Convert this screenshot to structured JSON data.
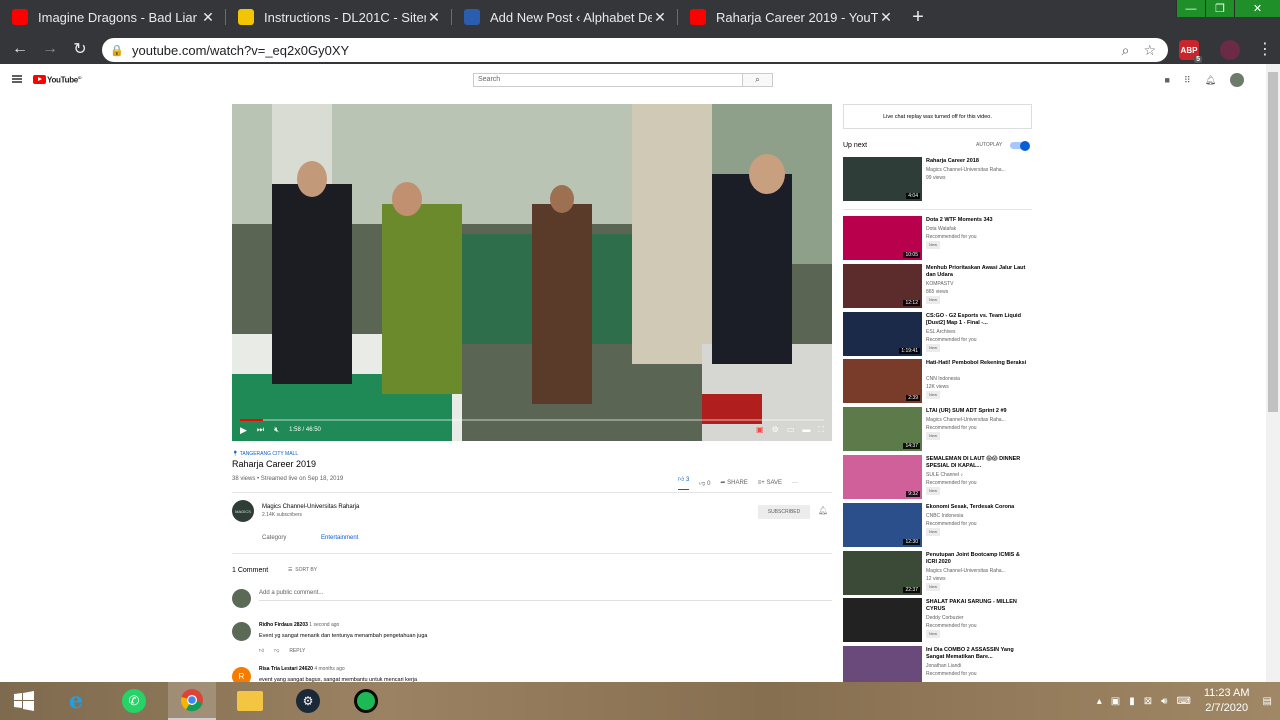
{
  "browser": {
    "tabs": [
      {
        "title": "Imagine Dragons - Bad Liar (Lyric",
        "favicon": "youtube",
        "active": false
      },
      {
        "title": "Instructions - DL201C - Sitem Ba",
        "favicon": "docs",
        "active": false
      },
      {
        "title": "Add New Post ‹ Alphabet Develo",
        "favicon": "alphabet",
        "active": false
      },
      {
        "title": "Raharja Career 2019 - YouTube",
        "favicon": "youtube",
        "active": true
      }
    ],
    "url": "youtube.com/watch?v=_eq2x0Gy0XY",
    "extension_badge": "5"
  },
  "youtube": {
    "search_placeholder": "Search",
    "video": {
      "time": "1:58 / 46:50",
      "location": "TANGERANG CITY MALL",
      "title": "Raharja Career 2019",
      "views": "38 views • Streamed live on Sep 18, 2019",
      "likes": "3",
      "dislikes": "0",
      "share_label": "SHARE",
      "save_label": "SAVE",
      "progress_fraction": 0.04
    },
    "channel": {
      "name": "Magics Channel-Universitas Raharja",
      "subscribers": "2.14K subscribers",
      "subscribe_label": "SUBSCRIBED",
      "avatar_text": "MAGICS"
    },
    "category_label": "Category",
    "category_value": "Entertainment",
    "comments": {
      "count": "1 Comment",
      "sort_label": "SORT BY",
      "add_placeholder": "Add a public comment...",
      "items": [
        {
          "author": "Ridho Firdaus 28203",
          "time": "1 second ago",
          "text": "Event yg sangat menarik dan tentunya menambah pengetahuan juga",
          "reply": "REPLY"
        },
        {
          "author": "Risa Tria Lestari 24620",
          "time": "4 months ago",
          "text": "event yang sangat bagus, sangat membantu untuk mencari kerja"
        }
      ]
    },
    "sidebar": {
      "chat_notice": "Live chat replay was turned off for this video.",
      "up_next": "Up next",
      "autoplay": "AUTOPLAY",
      "items": [
        {
          "title": "Raharja Career 2018",
          "channel": "Magics Channel-Universitas Raha...",
          "meta": "99 views",
          "duration": "4:04",
          "badge": "",
          "thumb_color": "#2f3d38"
        },
        {
          "title": "Dota 2 WTF Moments 343",
          "channel": "Dota Watafak",
          "meta": "Recommended for you",
          "duration": "10:05",
          "badge": "New",
          "thumb_color": "#b8004c"
        },
        {
          "title": "Menhub Prioritaskan Awasi Jalur Laut dan Udara",
          "channel": "KOMPASTV",
          "meta": "865 views",
          "duration": "12:12",
          "badge": "New",
          "thumb_color": "#5c2b2b"
        },
        {
          "title": "CS:GO - G2 Esports vs. Team Liquid [Dust2] Map 1 - Final -...",
          "channel": "ESL Archives",
          "meta": "Recommended for you",
          "duration": "1:19:41",
          "badge": "New",
          "thumb_color": "#1c2a4a"
        },
        {
          "title": "Hati-Hati! Pembobol Rekening Beraksi",
          "channel": "CNN Indonesia",
          "meta": "12K views",
          "duration": "2:39",
          "badge": "New",
          "thumb_color": "#7a3c2a"
        },
        {
          "title": "LTAI (UR) SUM ADT Sprint 2 #9",
          "channel": "Magics Channel-Universitas Raha...",
          "meta": "Recommended for you",
          "duration": "14:37",
          "badge": "New",
          "thumb_color": "#5d7a4a"
        },
        {
          "title": "SEMALEMAN DI LAUT 😱😱 DINNER SPESIAL DI KAPAL...",
          "channel": "SULE Channel ♪",
          "meta": "Recommended for you",
          "duration": "9:32",
          "badge": "New",
          "thumb_color": "#d0609a"
        },
        {
          "title": "Ekonomi Sesak, Terdesak Corona",
          "channel": "CNBC Indonesia",
          "meta": "Recommended for you",
          "duration": "12:30",
          "badge": "New",
          "thumb_color": "#2a4f8a"
        },
        {
          "title": "Penutupan Joint Bootcamp ICMIS & ICRI 2020",
          "channel": "Magics Channel-Universitas Raha...",
          "meta": "12 views",
          "duration": "22:37",
          "badge": "New",
          "thumb_color": "#3a4a36"
        },
        {
          "title": "SHALAT PAKAI SARUNG - MILLEN CYRUS",
          "channel": "Deddy Corbuzier",
          "meta": "Recommended for you",
          "duration": "",
          "badge": "New",
          "thumb_color": "#222"
        },
        {
          "title": "Ini Dia COMBO 2 ASSASSIN Yang Sangat Mematikan Bare...",
          "channel": "Jonathan Liandi",
          "meta": "Recommended for you",
          "duration": "",
          "badge": "",
          "thumb_color": "#6a4a7a"
        }
      ]
    }
  },
  "taskbar": {
    "time": "11:23 AM",
    "date": "2/7/2020"
  }
}
